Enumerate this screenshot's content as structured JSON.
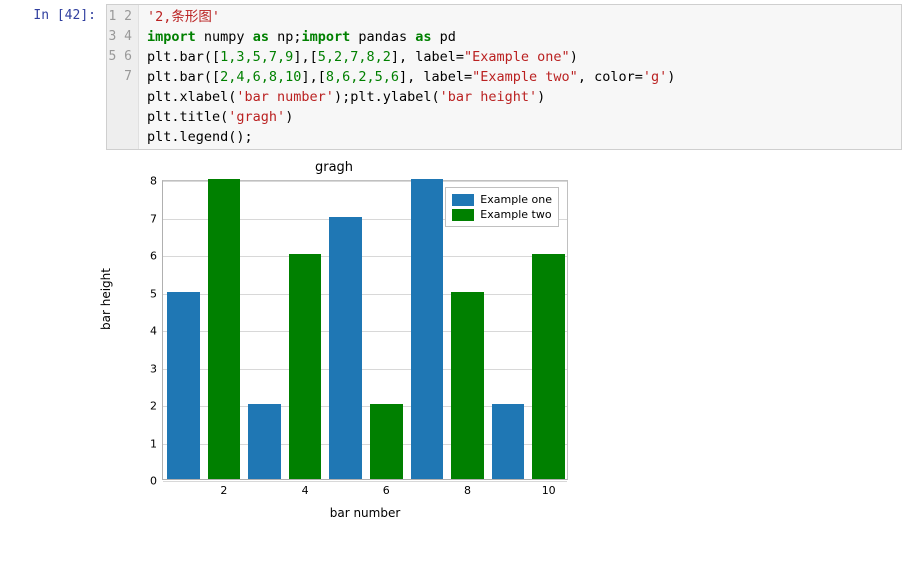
{
  "prompt": "In [42]:",
  "code": {
    "line_numbers": [
      "1",
      "2",
      "3",
      "4",
      "5",
      "6",
      "7"
    ],
    "l1_str": "'2,条形图'",
    "l2_kw1": "import",
    "l2_id1": " numpy ",
    "l2_kw2": "as",
    "l2_id2": " np;",
    "l2_kw3": "import",
    "l2_id3": " pandas ",
    "l2_kw4": "as",
    "l2_id4": " pd",
    "l3_a": "plt.bar([",
    "l3_n": "1,3,5,7,9",
    "l3_b": "],[",
    "l3_n2": "5,2,7,8,2",
    "l3_c": "], label=",
    "l3_s": "\"Example one\"",
    "l3_d": ")",
    "l4_a": "plt.bar([",
    "l4_n": "2,4,6,8,10",
    "l4_b": "],[",
    "l4_n2": "8,6,2,5,6",
    "l4_c": "], label=",
    "l4_s": "\"Example two\"",
    "l4_d": ", color=",
    "l4_s2": "'g'",
    "l4_e": ")",
    "l5_a": "plt.xlabel(",
    "l5_s": "'bar number'",
    "l5_b": ");plt.ylabel(",
    "l5_s2": "'bar height'",
    "l5_c": ")",
    "l6_a": "plt.title(",
    "l6_s": "'gragh'",
    "l6_b": ")",
    "l7": "plt.legend();"
  },
  "chart_data": {
    "type": "bar",
    "title": "gragh",
    "xlabel": "bar number",
    "ylabel": "bar height",
    "xlim": [
      0.5,
      10.5
    ],
    "ylim": [
      0,
      8
    ],
    "xticks": [
      2,
      4,
      6,
      8,
      10
    ],
    "yticks": [
      0,
      1,
      2,
      3,
      4,
      5,
      6,
      7,
      8
    ],
    "series": [
      {
        "name": "Example one",
        "color": "#1f77b4",
        "x": [
          1,
          3,
          5,
          7,
          9
        ],
        "values": [
          5,
          2,
          7,
          8,
          2
        ]
      },
      {
        "name": "Example two",
        "color": "#008000",
        "x": [
          2,
          4,
          6,
          8,
          10
        ],
        "values": [
          8,
          6,
          2,
          5,
          6
        ]
      }
    ]
  }
}
